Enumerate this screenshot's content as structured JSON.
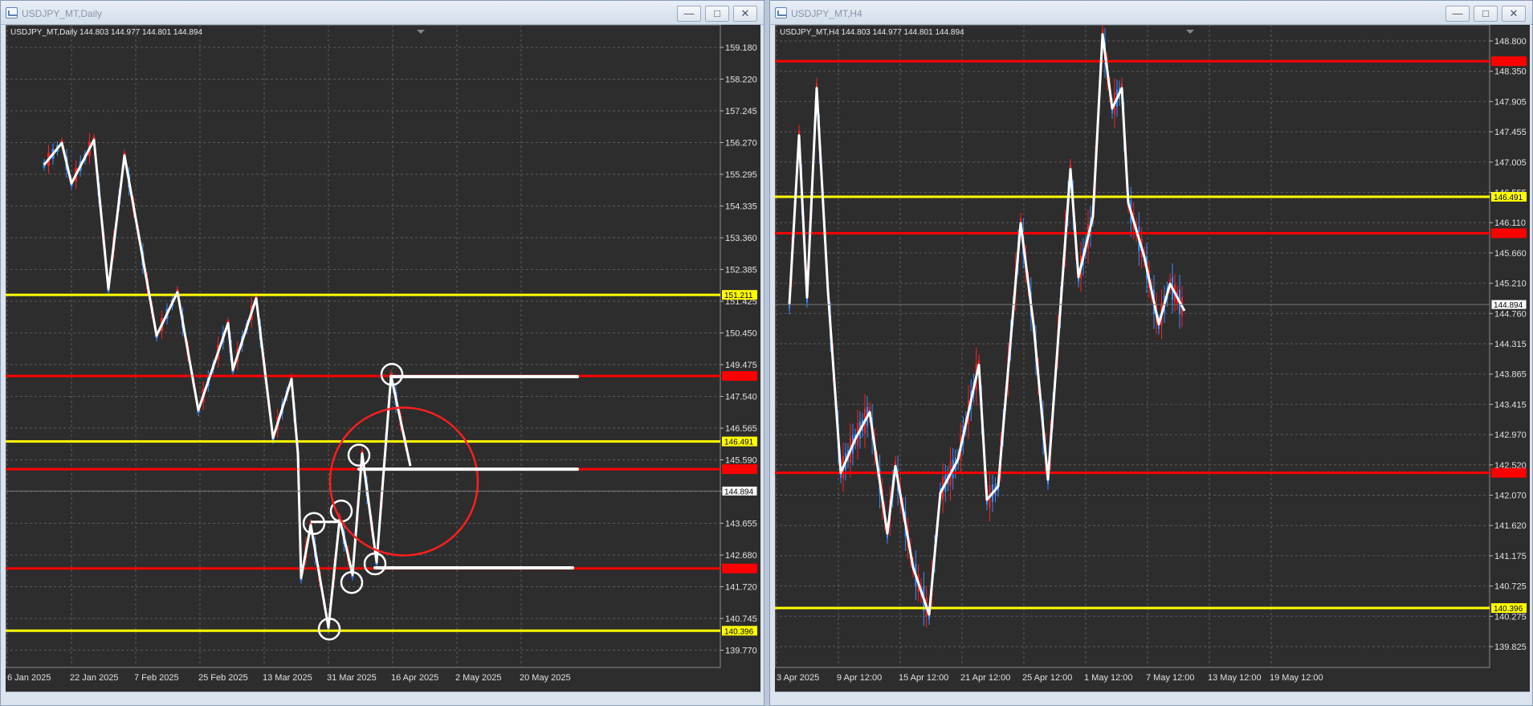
{
  "windows": [
    {
      "id": "daily",
      "title": "USDJPY_MT,Daily",
      "info": "USDJPY_MT,Daily  144.803 144.977 144.801 144.894",
      "buttons": [
        "—",
        "□",
        "✕"
      ],
      "price_axis": [
        "159.180",
        "158.220",
        "157.245",
        "156.270",
        "155.295",
        "154.335",
        "153.360",
        "152.385",
        "151.425",
        "150.450",
        "149.475",
        "147.540",
        "146.565",
        "145.590",
        "144.630",
        "143.655",
        "142.680",
        "141.720",
        "140.745",
        "139.770"
      ],
      "date_axis": [
        "6 Jan 2025",
        "22 Jan 2025",
        "7 Feb 2025",
        "25 Feb 2025",
        "13 Mar 2025",
        "31 Mar 2025",
        "16 Apr 2025",
        "2 May 2025",
        "20 May 2025"
      ],
      "current_price": "144.894",
      "levels": [
        {
          "price": 151.211,
          "label": "151.211",
          "color": "#ffff00"
        },
        {
          "price": 148.6,
          "label": "",
          "color": "#ff0000"
        },
        {
          "price": 146.491,
          "label": "146.491",
          "color": "#ffff00"
        },
        {
          "price": 145.6,
          "label": "",
          "color": "#ff0000"
        },
        {
          "price": 142.4,
          "label": "",
          "color": "#ff0000"
        },
        {
          "price": 140.396,
          "label": "140.396",
          "color": "#ffff00"
        }
      ]
    },
    {
      "id": "h4",
      "title": "USDJPY_MT,H4",
      "info": "USDJPY_MT,H4  144.803 144.977 144.801 144.894",
      "buttons": [
        "—",
        "□",
        "✕"
      ],
      "price_axis": [
        "148.800",
        "148.350",
        "147.905",
        "147.455",
        "147.005",
        "146.555",
        "146.110",
        "145.660",
        "145.210",
        "144.760",
        "144.315",
        "143.865",
        "143.415",
        "142.970",
        "142.520",
        "142.070",
        "141.620",
        "141.175",
        "140.725",
        "140.275",
        "139.825"
      ],
      "date_axis": [
        "3 Apr 2025",
        "9 Apr 12:00",
        "15 Apr 12:00",
        "21 Apr 12:00",
        "25 Apr 12:00",
        "1 May 12:00",
        "7 May 12:00",
        "13 May 12:00",
        "19 May 12:00"
      ],
      "current_price": "144.894",
      "levels": [
        {
          "price": 148.5,
          "label": "",
          "color": "#ff0000"
        },
        {
          "price": 146.491,
          "label": "146.491",
          "color": "#ffff00"
        },
        {
          "price": 145.95,
          "label": "",
          "color": "#ff0000"
        },
        {
          "price": 142.4,
          "label": "",
          "color": "#ff0000"
        },
        {
          "price": 140.396,
          "label": "140.396",
          "color": "#ffff00"
        }
      ]
    }
  ]
}
